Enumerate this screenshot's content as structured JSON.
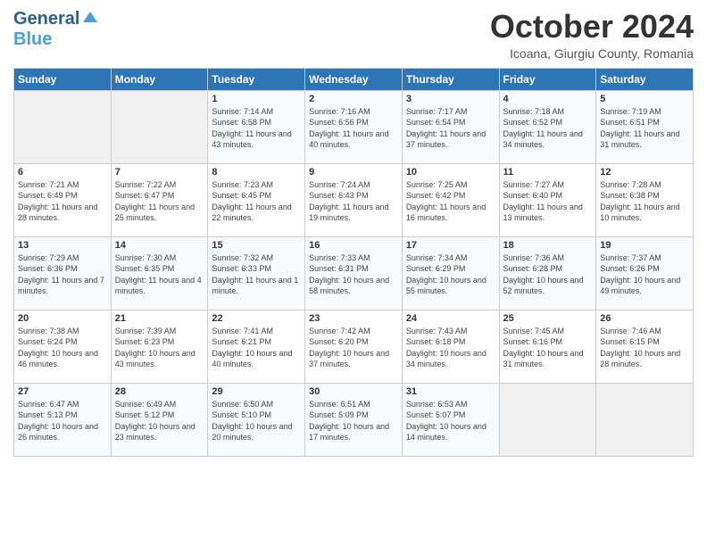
{
  "header": {
    "logo_line1": "General",
    "logo_line2": "Blue",
    "month_title": "October 2024",
    "subtitle": "Icoana, Giurgiu County, Romania"
  },
  "days_of_week": [
    "Sunday",
    "Monday",
    "Tuesday",
    "Wednesday",
    "Thursday",
    "Friday",
    "Saturday"
  ],
  "weeks": [
    [
      {
        "day": "",
        "content": ""
      },
      {
        "day": "",
        "content": ""
      },
      {
        "day": "1",
        "content": "Sunrise: 7:14 AM\nSunset: 6:58 PM\nDaylight: 11 hours and 43 minutes."
      },
      {
        "day": "2",
        "content": "Sunrise: 7:16 AM\nSunset: 6:56 PM\nDaylight: 11 hours and 40 minutes."
      },
      {
        "day": "3",
        "content": "Sunrise: 7:17 AM\nSunset: 6:54 PM\nDaylight: 11 hours and 37 minutes."
      },
      {
        "day": "4",
        "content": "Sunrise: 7:18 AM\nSunset: 6:52 PM\nDaylight: 11 hours and 34 minutes."
      },
      {
        "day": "5",
        "content": "Sunrise: 7:19 AM\nSunset: 6:51 PM\nDaylight: 11 hours and 31 minutes."
      }
    ],
    [
      {
        "day": "6",
        "content": "Sunrise: 7:21 AM\nSunset: 6:49 PM\nDaylight: 11 hours and 28 minutes."
      },
      {
        "day": "7",
        "content": "Sunrise: 7:22 AM\nSunset: 6:47 PM\nDaylight: 11 hours and 25 minutes."
      },
      {
        "day": "8",
        "content": "Sunrise: 7:23 AM\nSunset: 6:45 PM\nDaylight: 11 hours and 22 minutes."
      },
      {
        "day": "9",
        "content": "Sunrise: 7:24 AM\nSunset: 6:43 PM\nDaylight: 11 hours and 19 minutes."
      },
      {
        "day": "10",
        "content": "Sunrise: 7:25 AM\nSunset: 6:42 PM\nDaylight: 11 hours and 16 minutes."
      },
      {
        "day": "11",
        "content": "Sunrise: 7:27 AM\nSunset: 6:40 PM\nDaylight: 11 hours and 13 minutes."
      },
      {
        "day": "12",
        "content": "Sunrise: 7:28 AM\nSunset: 6:38 PM\nDaylight: 11 hours and 10 minutes."
      }
    ],
    [
      {
        "day": "13",
        "content": "Sunrise: 7:29 AM\nSunset: 6:36 PM\nDaylight: 11 hours and 7 minutes."
      },
      {
        "day": "14",
        "content": "Sunrise: 7:30 AM\nSunset: 6:35 PM\nDaylight: 11 hours and 4 minutes."
      },
      {
        "day": "15",
        "content": "Sunrise: 7:32 AM\nSunset: 6:33 PM\nDaylight: 11 hours and 1 minute."
      },
      {
        "day": "16",
        "content": "Sunrise: 7:33 AM\nSunset: 6:31 PM\nDaylight: 10 hours and 58 minutes."
      },
      {
        "day": "17",
        "content": "Sunrise: 7:34 AM\nSunset: 6:29 PM\nDaylight: 10 hours and 55 minutes."
      },
      {
        "day": "18",
        "content": "Sunrise: 7:36 AM\nSunset: 6:28 PM\nDaylight: 10 hours and 52 minutes."
      },
      {
        "day": "19",
        "content": "Sunrise: 7:37 AM\nSunset: 6:26 PM\nDaylight: 10 hours and 49 minutes."
      }
    ],
    [
      {
        "day": "20",
        "content": "Sunrise: 7:38 AM\nSunset: 6:24 PM\nDaylight: 10 hours and 46 minutes."
      },
      {
        "day": "21",
        "content": "Sunrise: 7:39 AM\nSunset: 6:23 PM\nDaylight: 10 hours and 43 minutes."
      },
      {
        "day": "22",
        "content": "Sunrise: 7:41 AM\nSunset: 6:21 PM\nDaylight: 10 hours and 40 minutes."
      },
      {
        "day": "23",
        "content": "Sunrise: 7:42 AM\nSunset: 6:20 PM\nDaylight: 10 hours and 37 minutes."
      },
      {
        "day": "24",
        "content": "Sunrise: 7:43 AM\nSunset: 6:18 PM\nDaylight: 10 hours and 34 minutes."
      },
      {
        "day": "25",
        "content": "Sunrise: 7:45 AM\nSunset: 6:16 PM\nDaylight: 10 hours and 31 minutes."
      },
      {
        "day": "26",
        "content": "Sunrise: 7:46 AM\nSunset: 6:15 PM\nDaylight: 10 hours and 28 minutes."
      }
    ],
    [
      {
        "day": "27",
        "content": "Sunrise: 6:47 AM\nSunset: 5:13 PM\nDaylight: 10 hours and 26 minutes."
      },
      {
        "day": "28",
        "content": "Sunrise: 6:49 AM\nSunset: 5:12 PM\nDaylight: 10 hours and 23 minutes."
      },
      {
        "day": "29",
        "content": "Sunrise: 6:50 AM\nSunset: 5:10 PM\nDaylight: 10 hours and 20 minutes."
      },
      {
        "day": "30",
        "content": "Sunrise: 6:51 AM\nSunset: 5:09 PM\nDaylight: 10 hours and 17 minutes."
      },
      {
        "day": "31",
        "content": "Sunrise: 6:53 AM\nSunset: 5:07 PM\nDaylight: 10 hours and 14 minutes."
      },
      {
        "day": "",
        "content": ""
      },
      {
        "day": "",
        "content": ""
      }
    ]
  ]
}
